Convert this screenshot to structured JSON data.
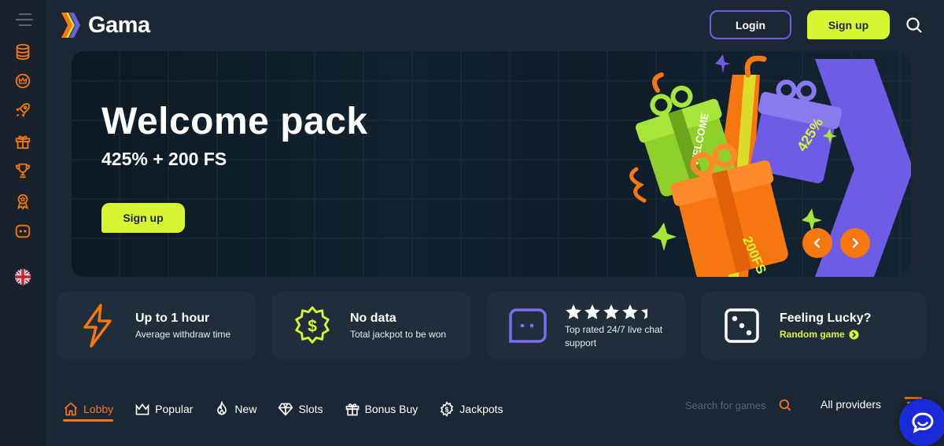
{
  "brand": {
    "name": "Gama",
    "accent": "#f6760f",
    "lime": "#d7f531",
    "purple": "#6e5ce6"
  },
  "sidebar": {
    "items": [
      {
        "icon": "coins-stack-icon"
      },
      {
        "icon": "crown-circle-icon"
      },
      {
        "icon": "rocket-icon"
      },
      {
        "icon": "gift-icon"
      },
      {
        "icon": "trophy-icon"
      },
      {
        "icon": "award-badge-icon"
      },
      {
        "icon": "chat-face-icon"
      }
    ],
    "language_icon": "uk-flag-icon"
  },
  "header": {
    "login_label": "Login",
    "signup_label": "Sign up"
  },
  "banner": {
    "title": "Welcome pack",
    "subtitle": "425% + 200 FS",
    "cta_label": "Sign up",
    "gift_labels": [
      "WELCOME",
      "425%",
      "200FS"
    ]
  },
  "features": [
    {
      "title": "Up to 1 hour",
      "desc": "Average withdraw time",
      "icon": "lightning-icon"
    },
    {
      "title": "No data",
      "desc": "Total jackpot to be won",
      "icon": "dollar-badge-icon"
    },
    {
      "rating": 4.5,
      "desc": "Top rated 24/7 live chat support",
      "icon": "chat-face-icon"
    },
    {
      "title": "Feeling Lucky?",
      "link": "Random game",
      "icon": "dice-icon"
    }
  ],
  "tabs": [
    {
      "label": "Lobby",
      "icon": "home-icon",
      "active": true
    },
    {
      "label": "Popular",
      "icon": "crown-icon",
      "active": false
    },
    {
      "label": "New",
      "icon": "flame-icon",
      "active": false
    },
    {
      "label": "Slots",
      "icon": "diamond-icon",
      "active": false
    },
    {
      "label": "Bonus Buy",
      "icon": "gift-icon",
      "active": false
    },
    {
      "label": "Jackpots",
      "icon": "dollar-badge-icon",
      "active": false
    }
  ],
  "search": {
    "placeholder": "Search for games"
  },
  "providers_label": "All providers"
}
